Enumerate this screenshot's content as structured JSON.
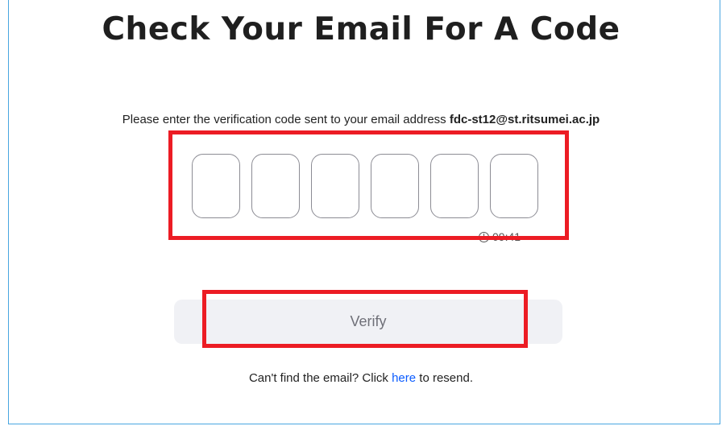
{
  "page": {
    "title": "Check Your Email For A Code",
    "instruction_text": "Please enter the verification code sent to your email address",
    "email": "fdc-st12@st.ritsumei.ac.jp"
  },
  "code_inputs": [
    {
      "value": ""
    },
    {
      "value": ""
    },
    {
      "value": ""
    },
    {
      "value": ""
    },
    {
      "value": ""
    },
    {
      "value": ""
    }
  ],
  "timer": {
    "icon": "clock-icon",
    "value": "09:41"
  },
  "verify_button": {
    "label": "Verify"
  },
  "resend": {
    "prefix": "Can't find the email? Click",
    "link_label": "here",
    "suffix": "to resend."
  },
  "colors": {
    "highlight": "#ec1c24",
    "link": "#0b5cff",
    "frame_border": "#48a6e0",
    "button_bg": "#f0f1f5"
  }
}
